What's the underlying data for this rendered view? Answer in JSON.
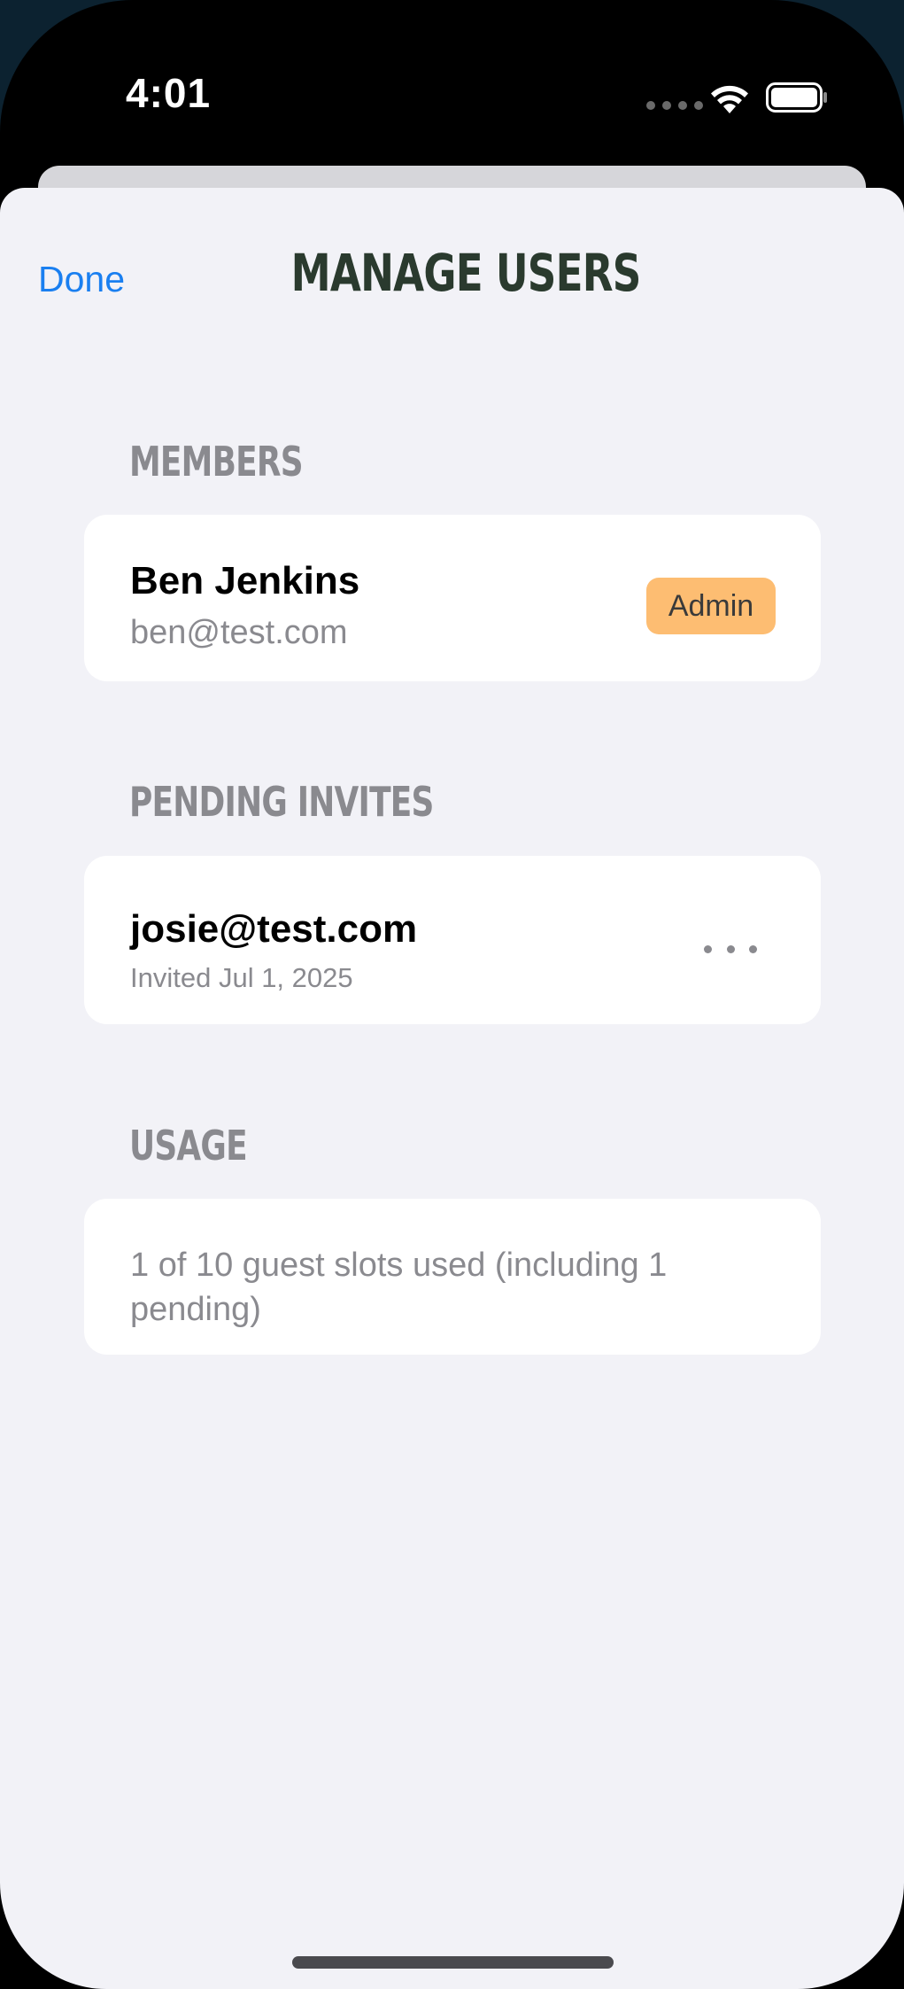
{
  "status_bar": {
    "time": "4:01",
    "icons": [
      "cellular-signal-icon",
      "wifi-icon",
      "battery-icon"
    ]
  },
  "nav": {
    "done_label": "Done",
    "title": "MANAGE USERS"
  },
  "members": {
    "header": "MEMBERS",
    "items": [
      {
        "name": "Ben Jenkins",
        "email": "ben@test.com",
        "role": "Admin"
      }
    ]
  },
  "pending_invites": {
    "header": "PENDING INVITES",
    "items": [
      {
        "email": "josie@test.com",
        "invited": "Invited Jul 1, 2025",
        "action_icon": "more-icon"
      }
    ]
  },
  "usage": {
    "header": "USAGE",
    "text": "1 of 10 guest slots used (including 1 pending)"
  },
  "colors": {
    "accent": "#1a7ff0",
    "title": "#2a3a2e",
    "badge": "#fdbd72",
    "secondary_text": "#8a8a8f",
    "sheet_bg": "#f2f2f7"
  }
}
